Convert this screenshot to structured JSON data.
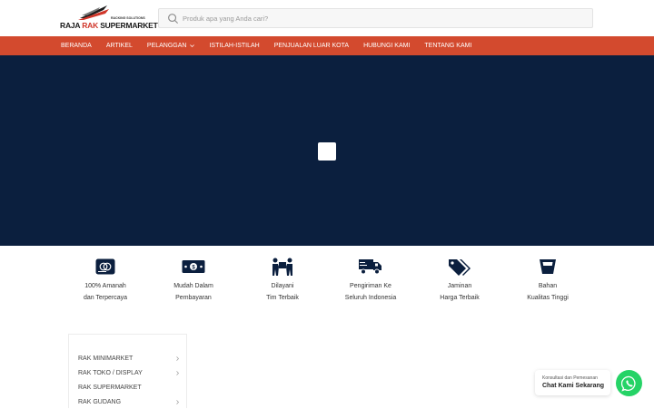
{
  "logo": {
    "brand_part1": "RAJA ",
    "brand_part2": "RAK",
    "brand_part3": " SUPERMARKET",
    "tagline": "RACKING SOLUTIONS"
  },
  "search": {
    "placeholder": "Produk apa yang Anda cari?",
    "icon": "search-icon"
  },
  "nav": {
    "items": [
      {
        "label": "BERANDA"
      },
      {
        "label": "ARTIKEL"
      },
      {
        "label": "PELANGGAN",
        "has_dropdown": true
      },
      {
        "label": "ISTILAH-ISTILAH"
      },
      {
        "label": "PENJUALAN LUAR KOTA"
      },
      {
        "label": "HUBUNGI KAMI"
      },
      {
        "label": "TENTANG KAMI"
      }
    ],
    "bg_color": "#d34a2e"
  },
  "hero": {
    "bg_color": "#0b1f3e"
  },
  "features": [
    {
      "icon": "credit-card-icon",
      "line1": "100% Amanah",
      "line2": "dan Terpercaya"
    },
    {
      "icon": "money-bill-icon",
      "line1": "Mudah Dalam",
      "line2": "Pembayaran"
    },
    {
      "icon": "people-carry-icon",
      "line1": "Dilayani",
      "line2": "Tim Terbaik"
    },
    {
      "icon": "truck-icon",
      "line1": "Pengiriman Ke",
      "line2": "Seluruh Indonesia"
    },
    {
      "icon": "price-tag-icon",
      "line1": "Jaminan",
      "line2": "Harga Terbaik"
    },
    {
      "icon": "bucket-icon",
      "line1": "Bahan",
      "line2": "Kualitas Tinggi"
    }
  ],
  "sidebar": {
    "items": [
      {
        "label": "RAK MINIMARKET",
        "has_submenu": true
      },
      {
        "label": "RAK TOKO / DISPLAY",
        "has_submenu": true
      },
      {
        "label": "RAK SUPERMARKET",
        "has_submenu": false
      },
      {
        "label": "RAK GUDANG",
        "has_submenu": true
      }
    ]
  },
  "chat": {
    "small_text": "Konsultasi dan Pemesanan",
    "big_text": "Chat Kami Sekarang",
    "icon": "whatsapp-icon",
    "color": "#25d366"
  }
}
